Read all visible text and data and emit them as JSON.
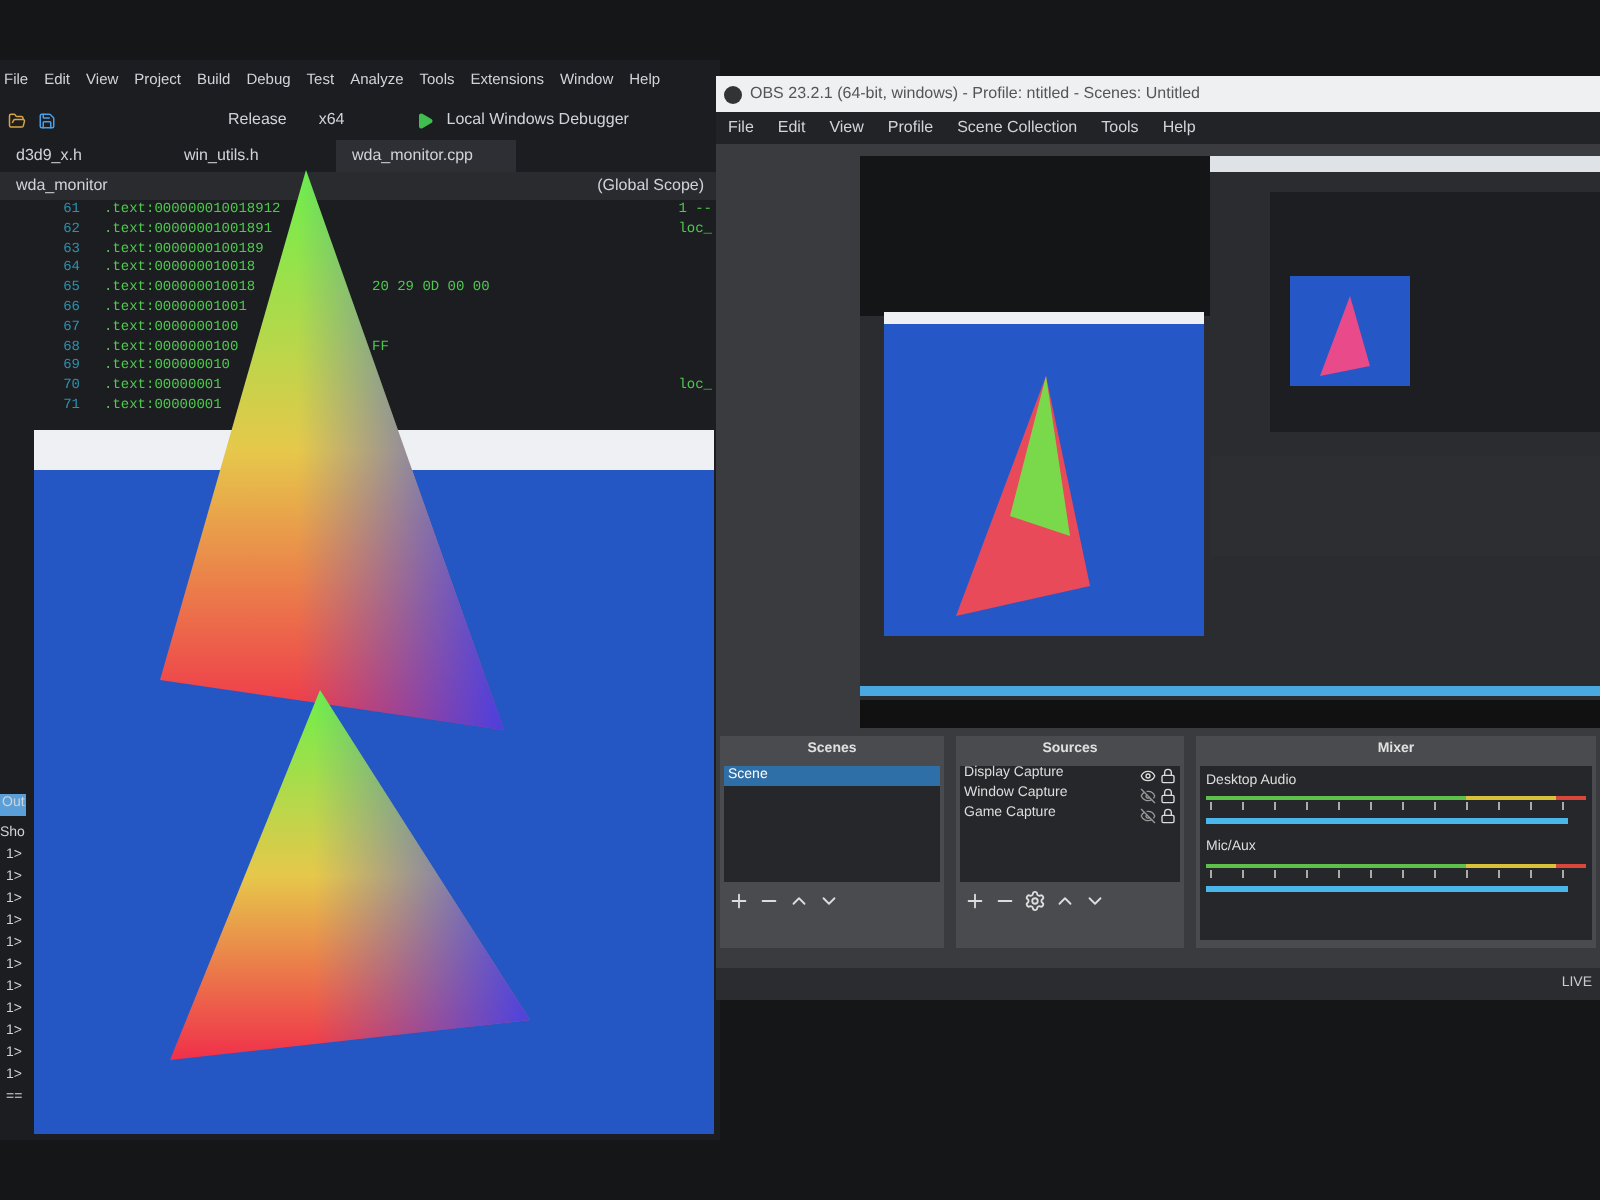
{
  "ide": {
    "menu": [
      "File",
      "Edit",
      "View",
      "Project",
      "Build",
      "Debug",
      "Test",
      "Analyze",
      "Tools",
      "Extensions",
      "Window",
      "Help"
    ],
    "toolbar": {
      "configuration": "Release",
      "platform": "x64",
      "run": "Local Windows Debugger"
    },
    "tabs": [
      {
        "label": "d3d9_x.h",
        "selected": false
      },
      {
        "label": "win_utils.h",
        "selected": false
      },
      {
        "label": "wda_monitor.cpp",
        "selected": true
      }
    ],
    "scope_bar": {
      "project": "wda_monitor",
      "scope": "(Global Scope)"
    },
    "code_lines": [
      {
        "num": "61",
        "text": ".text:000000010018912",
        "right": "1 --"
      },
      {
        "num": "62",
        "text": ".text:00000001001891",
        "right": "loc_"
      },
      {
        "num": "63",
        "text": ".text:0000000100189"
      },
      {
        "num": "64",
        "text": ".text:000000010018"
      },
      {
        "num": "65",
        "text": ".text:000000010018",
        "extra": "20 29 0D 00 00"
      },
      {
        "num": "66",
        "text": ".text:00000001001"
      },
      {
        "num": "67",
        "text": ".text:0000000100"
      },
      {
        "num": "68",
        "text": ".text:0000000100",
        "extra": "FF"
      },
      {
        "num": "69",
        "text": ".text:000000010"
      },
      {
        "num": "70",
        "text": ".text:00000001",
        "right": "loc_"
      },
      {
        "num": "71",
        "text": ".text:00000001"
      }
    ],
    "output": {
      "tab": "Out",
      "label": "Sho",
      "lines": [
        "1>",
        "1>",
        "1>",
        "1>",
        "1>",
        "1>",
        "1>",
        "1>",
        "1>",
        "1>",
        "1>",
        "=="
      ]
    }
  },
  "obs": {
    "title": "OBS 23.2.1 (64-bit, windows) - Profile: ntitled - Scenes: Untitled",
    "menu": [
      "File",
      "Edit",
      "View",
      "Profile",
      "Scene Collection",
      "Tools",
      "Help"
    ],
    "scenes": {
      "title": "Scenes",
      "items": [
        {
          "label": "Scene",
          "selected": true
        }
      ]
    },
    "sources": {
      "title": "Sources",
      "items": [
        {
          "label": "Display Capture",
          "visible": true
        },
        {
          "label": "Window Capture",
          "visible": false
        },
        {
          "label": "Game Capture",
          "visible": false
        }
      ]
    },
    "mixer": {
      "title": "Mixer",
      "channels": [
        {
          "name": "Desktop Audio",
          "level": 0.95
        },
        {
          "name": "Mic/Aux",
          "level": 0.95
        }
      ]
    },
    "status": "LIVE"
  }
}
